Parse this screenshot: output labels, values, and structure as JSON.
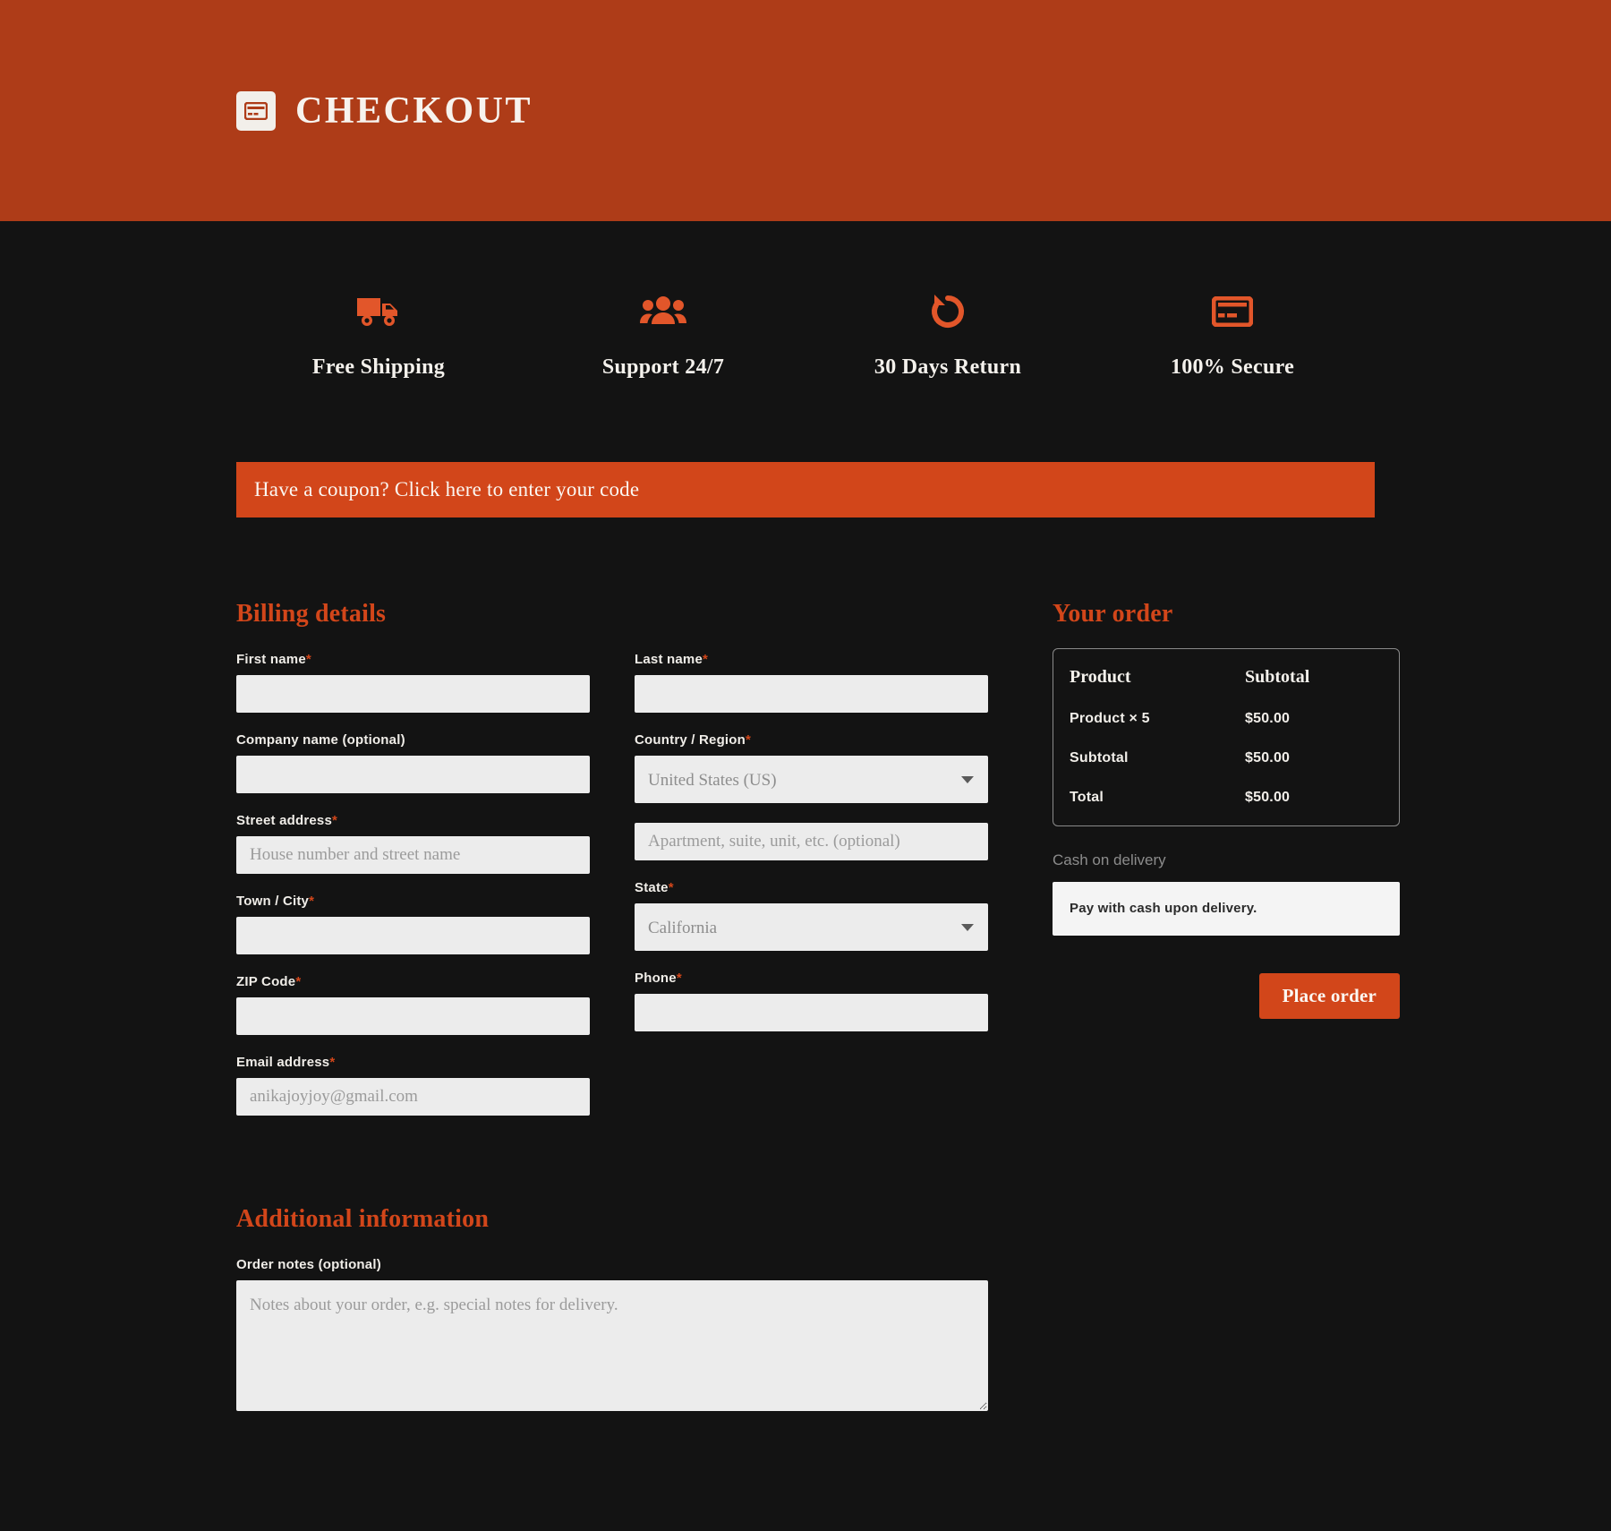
{
  "header": {
    "title": "CHECKOUT",
    "logo_icon": "credit-card-icon"
  },
  "features": [
    {
      "icon": "truck-icon",
      "label": "Free Shipping"
    },
    {
      "icon": "users-group-icon",
      "label": "Support 24/7"
    },
    {
      "icon": "rotate-left-icon",
      "label": "30 Days Return"
    },
    {
      "icon": "credit-card-icon",
      "label": "100% Secure"
    }
  ],
  "coupon": {
    "text": "Have a coupon? Click here to enter your code"
  },
  "billing": {
    "title": "Billing details",
    "first_name": {
      "label": "First name",
      "required": "*",
      "value": "",
      "placeholder": ""
    },
    "last_name": {
      "label": "Last name",
      "required": "*",
      "value": "",
      "placeholder": ""
    },
    "company": {
      "label": "Company name (optional)",
      "value": "",
      "placeholder": ""
    },
    "country": {
      "label": "Country / Region",
      "required": "*",
      "value": "United States (US)"
    },
    "street": {
      "label": "Street address",
      "required": "*",
      "value": "",
      "placeholder": "House number and street name"
    },
    "apartment": {
      "value": "",
      "placeholder": "Apartment, suite, unit, etc. (optional)"
    },
    "city": {
      "label": "Town / City",
      "required": "*",
      "value": "",
      "placeholder": ""
    },
    "state": {
      "label": "State",
      "required": "*",
      "value": "California"
    },
    "zip": {
      "label": "ZIP Code",
      "required": "*",
      "value": "",
      "placeholder": ""
    },
    "phone": {
      "label": "Phone",
      "required": "*",
      "value": "",
      "placeholder": ""
    },
    "email": {
      "label": "Email address",
      "required": "*",
      "value": "",
      "placeholder": "anikajoyjoy@gmail.com"
    }
  },
  "additional": {
    "title": "Additional information",
    "notes": {
      "label": "Order notes (optional)",
      "value": "",
      "placeholder": "Notes about your order, e.g. special notes for delivery."
    }
  },
  "order": {
    "title": "Your order",
    "columns": {
      "product": "Product",
      "subtotal": "Subtotal"
    },
    "rows": [
      {
        "name": "Product  × 5",
        "amount": "$50.00"
      },
      {
        "name": "Subtotal",
        "amount": "$50.00"
      },
      {
        "name": "Total",
        "amount": "$50.00"
      }
    ],
    "payment_method": "Cash on delivery",
    "payment_description": "Pay with cash upon delivery.",
    "place_order_label": "Place order"
  },
  "colors": {
    "header_bg": "#AE3C18",
    "accent": "#D2461A",
    "page_bg": "#131313",
    "input_bg": "#ECECEC",
    "text_light": "#F4F1EC"
  }
}
